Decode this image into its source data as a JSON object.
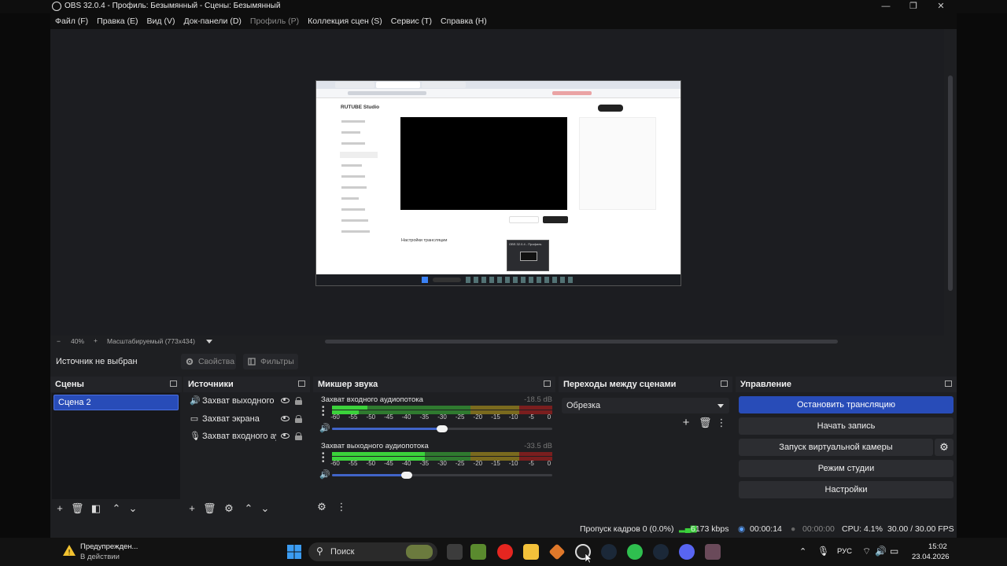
{
  "window": {
    "title": "OBS 32.0.4 - Профиль: Безымянный - Сцены: Безымянный",
    "minimize": "—",
    "maximize": "❐",
    "close": "✕"
  },
  "menu": {
    "items": [
      "Файл (F)",
      "Правка (E)",
      "Вид (V)",
      "Док-панели (D)",
      "Профиль (P)",
      "Коллекция сцен (S)",
      "Сервис (T)",
      "Справка (H)"
    ]
  },
  "preview": {
    "page_brand": "RUTUBE Studio",
    "settings_heading": "Настройки трансляции",
    "popup_label": "OBS 32.0.4 - Профиль"
  },
  "zoom": {
    "minus": "−",
    "percent": "40%",
    "plus": "+",
    "mode": "Масштабируемый (773x434)"
  },
  "source_bar": {
    "selected_label": "Источник не выбран",
    "properties_label": "Свойства",
    "filters_label": "Фильтры"
  },
  "scenes": {
    "title": "Сцены",
    "items": [
      "Сцена 2"
    ]
  },
  "sources": {
    "title": "Источники",
    "items": [
      {
        "label": "Захват выходного аудиопотока",
        "icon": "speaker-icon"
      },
      {
        "label": "Захват экрана",
        "icon": "monitor-icon"
      },
      {
        "label": "Захват входного аудиопотока",
        "icon": "microphone-icon"
      }
    ]
  },
  "mixer": {
    "title": "Микшер звука",
    "scale": [
      "-60",
      "-55",
      "-50",
      "-45",
      "-40",
      "-35",
      "-30",
      "-25",
      "-20",
      "-15",
      "-10",
      "-5",
      "0"
    ],
    "channels": [
      {
        "name": "Захват входного аудиопотока",
        "db": "-18.5 dB",
        "volume": 0.5
      },
      {
        "name": "Захват выходного аудиопотока",
        "db": "-33.5 dB",
        "volume": 0.34
      }
    ]
  },
  "transitions": {
    "title": "Переходы между сценами",
    "selected": "Обрезка"
  },
  "controls": {
    "title": "Управление",
    "stop_stream": "Остановить трансляцию",
    "start_record": "Начать запись",
    "virtual_cam": "Запуск виртуальной камеры",
    "studio_mode": "Режим студии",
    "settings": "Настройки"
  },
  "status": {
    "dropped_frames": "Пропуск кадров 0 (0.0%)",
    "bitrate": "6173 kbps",
    "stream_time": "00:00:14",
    "record_time": "00:00:00",
    "cpu": "CPU: 4.1%",
    "fps": "30.00 / 30.00 FPS"
  },
  "taskbar": {
    "notification_title": "Предупрежден...",
    "notification_sub": "В действии",
    "search_placeholder": "Поиск",
    "lang": "РУС",
    "time": "15:02",
    "date": "23.04.2026"
  },
  "colors": {
    "accent": "#284cb8",
    "meter_green": "#3bd23b",
    "meter_yellow": "#c8b428",
    "meter_red": "#c82828"
  }
}
